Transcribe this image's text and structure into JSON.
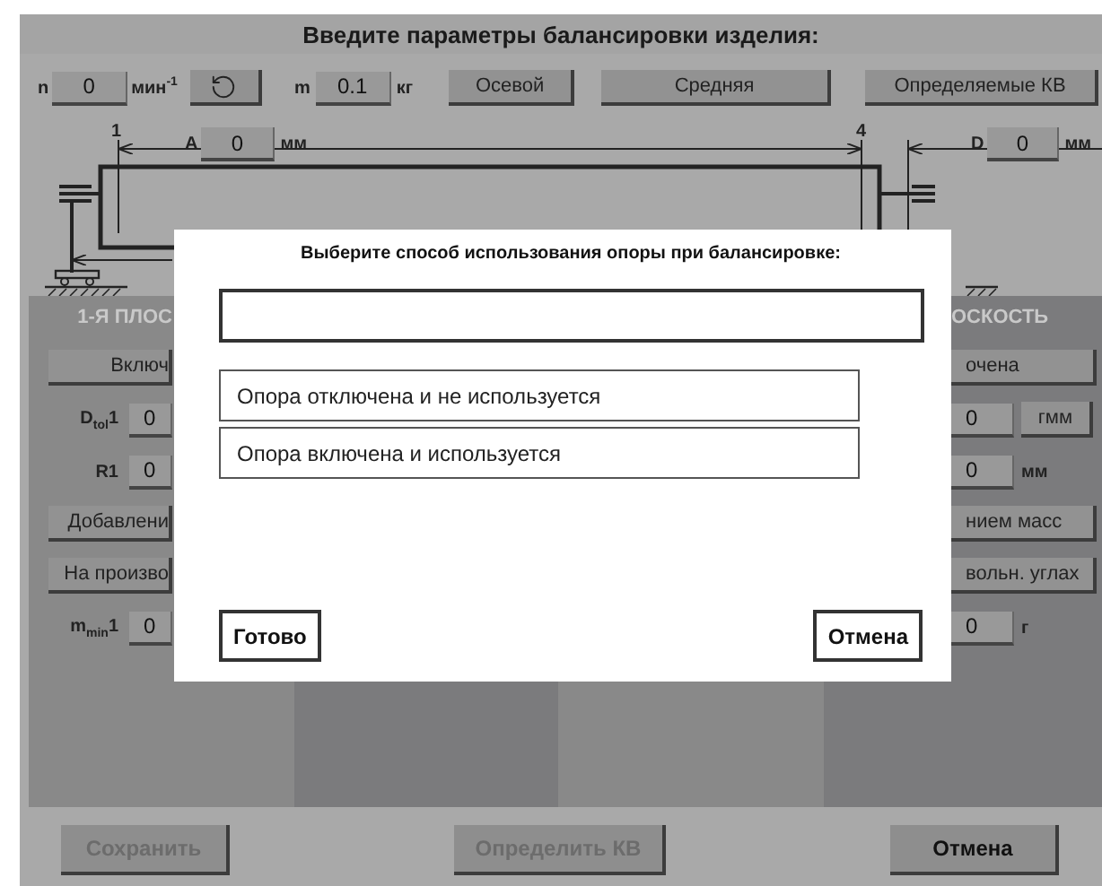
{
  "title": "Введите параметры балансировки изделия:",
  "top_bar": {
    "speed": {
      "label": "n",
      "value": "0",
      "unit": "мин$^{-1}$"
    },
    "mass": {
      "label": "m",
      "value": "0.1",
      "unit": "кг"
    },
    "mode_buttons": [
      "Осевой",
      "Средняя",
      "Определяемые КВ"
    ]
  },
  "diagram": {
    "support_labels": [
      "1",
      "4"
    ],
    "dim_a": {
      "label": "A",
      "value": "0",
      "unit": "мм"
    },
    "dim_d": {
      "label": "D",
      "value": "0",
      "unit": "мм"
    }
  },
  "planes": [
    {
      "header": "1-Я ПЛОС",
      "items": [
        {
          "kind": "button",
          "label": "Включ"
        },
        {
          "kind": "field",
          "label": "D$_{tol}$1",
          "value": "0"
        },
        {
          "kind": "field",
          "label": "R1",
          "value": "0"
        },
        {
          "kind": "button",
          "label": "Добавлени"
        },
        {
          "kind": "button",
          "label": "На произво"
        },
        {
          "kind": "field",
          "label": "m$_{min}$1",
          "value": "0"
        }
      ]
    },
    {
      "header": "ОСКОСТЬ",
      "items": [
        {
          "kind": "button",
          "label": "очена"
        },
        {
          "kind": "field",
          "value": "0",
          "unit": "гмм",
          "unit_boxed": true
        },
        {
          "kind": "field",
          "value": "0",
          "unit": "мм",
          "unit_boxed": false
        },
        {
          "kind": "button",
          "label": "нием масс"
        },
        {
          "kind": "button",
          "label": "вольн. углах"
        },
        {
          "kind": "field",
          "value": "0",
          "unit": "г",
          "unit_boxed": false
        }
      ]
    }
  ],
  "dialog": {
    "title": "Выберите способ использования опоры при балансировке:",
    "options": [
      {
        "label": "Опора отключена и не используется",
        "selected": false
      },
      {
        "label": "Опора включена и используется",
        "selected": false
      }
    ],
    "buttons": [
      "Готово",
      "Отмена"
    ]
  },
  "footer_buttons": [
    {
      "label": "Сохранить",
      "disabled": true
    },
    {
      "label": "Определить КВ",
      "disabled": true
    },
    {
      "label": "Отмена",
      "disabled": false
    }
  ]
}
